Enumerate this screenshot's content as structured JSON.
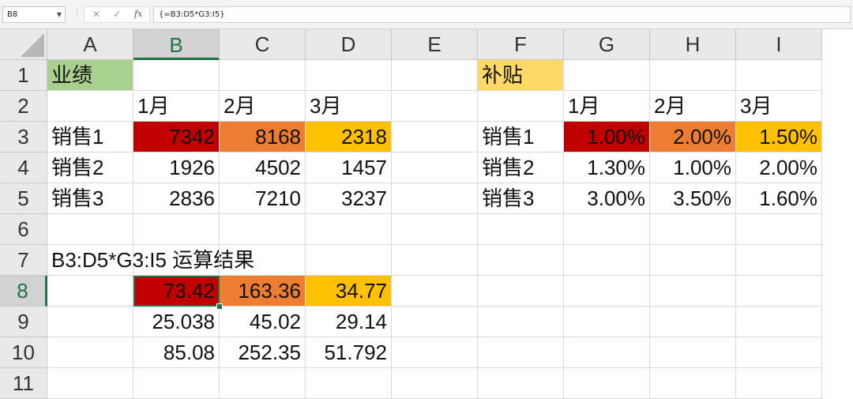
{
  "formula_bar": {
    "name_box": "B8",
    "formula": "{=B3:D5*G3:I5}",
    "icons": [
      "cancel-icon",
      "enter-icon",
      "function-icon"
    ]
  },
  "columns": [
    "A",
    "B",
    "C",
    "D",
    "E",
    "F",
    "G",
    "H",
    "I"
  ],
  "rows": [
    "1",
    "2",
    "3",
    "4",
    "5",
    "6",
    "7",
    "8",
    "9",
    "10",
    "11"
  ],
  "selected_cell": {
    "column": "B",
    "row": "8"
  },
  "colors": {
    "header_green": "#a9d08e",
    "header_yellow": "#ffd966",
    "red": "#c00000",
    "orange": "#ed7d31",
    "amber": "#ffc000",
    "selection": "#217346"
  },
  "cells": {
    "A1": "业绩",
    "B2": "1月",
    "C2": "2月",
    "D2": "3月",
    "A3": "销售1",
    "B3": "7342",
    "C3": "8168",
    "D3": "2318",
    "A4": "销售2",
    "B4": "1926",
    "C4": "4502",
    "D4": "1457",
    "A5": "销售3",
    "B5": "2836",
    "C5": "7210",
    "D5": "3237",
    "F1": "补贴",
    "G2": "1月",
    "H2": "2月",
    "I2": "3月",
    "F3": "销售1",
    "G3": "1.00%",
    "H3": "2.00%",
    "I3": "1.50%",
    "F4": "销售2",
    "G4": "1.30%",
    "H4": "1.00%",
    "I4": "2.00%",
    "F5": "销售3",
    "G5": "3.00%",
    "H5": "3.50%",
    "I5": "1.60%",
    "A7": "B3:D5*G3:I5 运算结果",
    "B8": "73.42",
    "C8": "163.36",
    "D8": "34.77",
    "B9": "25.038",
    "C9": "45.02",
    "D9": "29.14",
    "B10": "85.08",
    "C10": "252.35",
    "D10": "51.792"
  }
}
